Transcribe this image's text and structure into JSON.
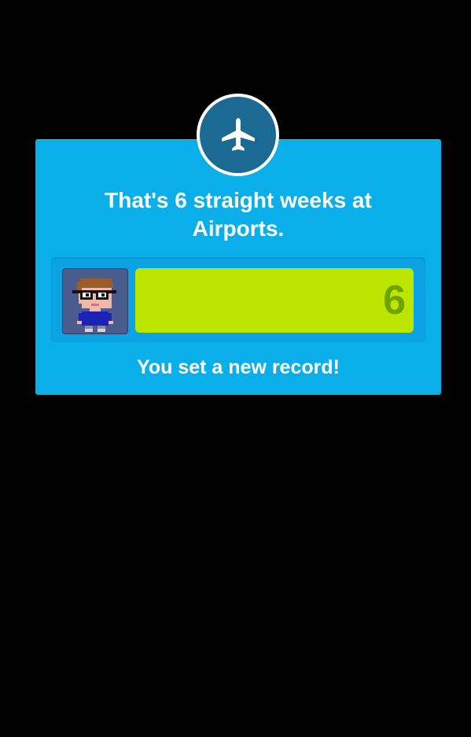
{
  "colors": {
    "background": "#000000",
    "card": "#0aaee8",
    "badge_ring": "#ffffff",
    "badge_fill": "#1a6a93",
    "bar_fill": "#bce600",
    "bar_count_text": "#6ea400",
    "text": "#ffffff"
  },
  "badge": {
    "icon": "airplane-icon"
  },
  "headline": {
    "line1": "That's 6 straight weeks at",
    "line2": "Airports."
  },
  "progress": {
    "avatar_icon": "pixel-avatar-icon",
    "count": "6",
    "fill_fraction": 1.0
  },
  "footer": {
    "record_text": "You set a new record!"
  }
}
